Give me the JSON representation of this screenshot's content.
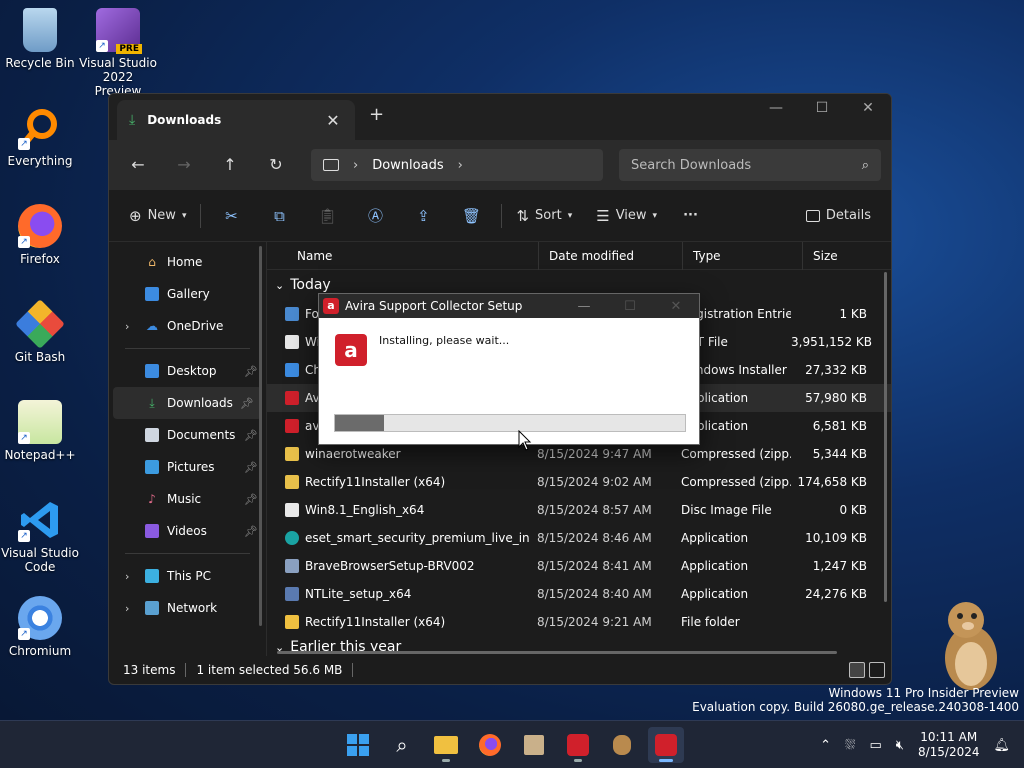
{
  "desktop": {
    "icons": [
      {
        "label": "Recycle Bin"
      },
      {
        "label": "Visual Studio 2022 Preview",
        "badge": "PRE"
      },
      {
        "label": "Everything"
      },
      {
        "label": "Firefox"
      },
      {
        "label": "Git Bash"
      },
      {
        "label": "Notepad++"
      },
      {
        "label": "Visual Studio Code"
      },
      {
        "label": "Chromium"
      }
    ]
  },
  "explorer": {
    "tab_title": "Downloads",
    "address": {
      "crumb": "Downloads"
    },
    "search_placeholder": "Search Downloads",
    "toolbar": {
      "new": "New",
      "sort": "Sort",
      "view": "View",
      "more": "···",
      "details": "Details"
    },
    "sidebar": {
      "items": [
        {
          "label": "Home"
        },
        {
          "label": "Gallery"
        },
        {
          "label": "OneDrive"
        },
        {
          "label": "Desktop"
        },
        {
          "label": "Downloads"
        },
        {
          "label": "Documents"
        },
        {
          "label": "Pictures"
        },
        {
          "label": "Music"
        },
        {
          "label": "Videos"
        },
        {
          "label": "This PC"
        },
        {
          "label": "Network"
        }
      ]
    },
    "columns": [
      "Name",
      "Date modified",
      "Type",
      "Size"
    ],
    "groups": {
      "today": "Today",
      "earlier": "Earlier this year"
    },
    "rows": [
      {
        "name": "Fo",
        "date": "",
        "type": "Registration Entries",
        "size": "1 KB"
      },
      {
        "name": "Wi",
        "date": "",
        "type": "ART File",
        "size": "3,951,152 KB"
      },
      {
        "name": "Ch",
        "date": "",
        "type": "Windows Installer ...",
        "size": "27,332 KB"
      },
      {
        "name": "Av",
        "date": "",
        "type": "Application",
        "size": "57,980 KB"
      },
      {
        "name": "av",
        "date": "",
        "type": "Application",
        "size": "6,581 KB"
      },
      {
        "name": "winaerotweaker",
        "date": "8/15/2024 9:47 AM",
        "type": "Compressed (zipp...",
        "size": "5,344 KB"
      },
      {
        "name": "Rectify11Installer (x64)",
        "date": "8/15/2024 9:02 AM",
        "type": "Compressed (zipp...",
        "size": "174,658 KB"
      },
      {
        "name": "Win8.1_English_x64",
        "date": "8/15/2024 8:57 AM",
        "type": "Disc Image File",
        "size": "0 KB"
      },
      {
        "name": "eset_smart_security_premium_live_installer",
        "date": "8/15/2024 8:46 AM",
        "type": "Application",
        "size": "10,109 KB"
      },
      {
        "name": "BraveBrowserSetup-BRV002",
        "date": "8/15/2024 8:41 AM",
        "type": "Application",
        "size": "1,247 KB"
      },
      {
        "name": "NTLite_setup_x64",
        "date": "8/15/2024 8:40 AM",
        "type": "Application",
        "size": "24,276 KB"
      },
      {
        "name": "Rectify11Installer (x64)",
        "date": "8/15/2024 9:21 AM",
        "type": "File folder",
        "size": ""
      }
    ],
    "status": {
      "count": "13 items",
      "selection": "1 item selected  56.6 MB"
    }
  },
  "dialog": {
    "title": "Avira Support Collector Setup",
    "message": "Installing, please wait...",
    "progress": 0.14
  },
  "watermark": {
    "line1": "Windows 11 Pro Insider Preview",
    "line2": "Evaluation copy. Build 26080.ge_release.240308-1400"
  },
  "taskbar": {
    "time": "10:11 AM",
    "date": "8/15/2024"
  },
  "colors": {
    "avira_red": "#d0202b",
    "accent_blue": "#8ec3ff",
    "downloads_green": "#46b36a"
  }
}
